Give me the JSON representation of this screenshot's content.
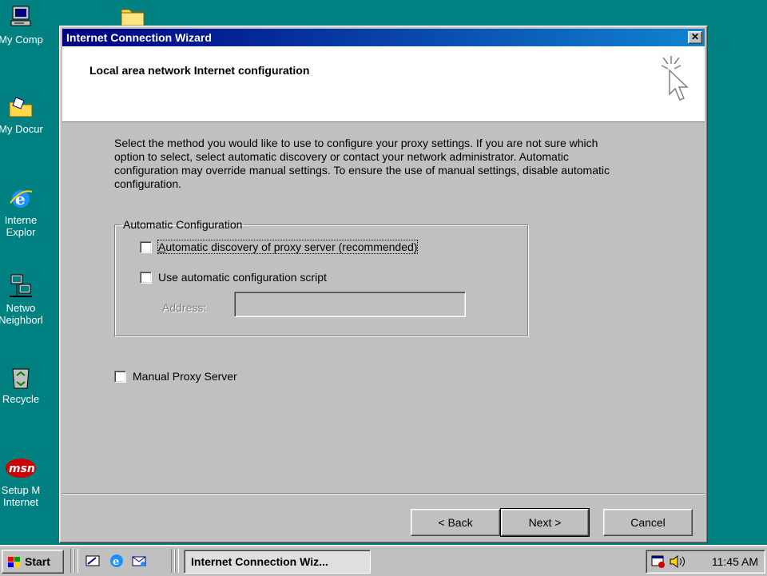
{
  "desktop": {
    "icons": [
      {
        "label": "My Comp",
        "icon": "my-computer-icon"
      },
      {
        "label": "",
        "icon": "folder-icon"
      },
      {
        "label": "My Docur",
        "icon": "my-documents-icon"
      },
      {
        "label": "Interne\nExplor",
        "icon": "internet-explorer-icon"
      },
      {
        "label": "Netwo\nNeighborl",
        "icon": "network-neighborhood-icon"
      },
      {
        "label": "Recycle",
        "icon": "recycle-bin-icon"
      },
      {
        "label": "Setup M\nInternet",
        "icon": "msn-icon"
      }
    ]
  },
  "window": {
    "title": "Internet Connection Wizard",
    "close_glyph": "✕",
    "header_title": "Local area network Internet configuration",
    "description": "Select the method you would like to use to configure your proxy settings.  If you are not sure which option to select, select automatic discovery or contact your network administrator.  Automatic configuration may override manual settings.  To ensure the use of manual settings, disable automatic configuration.",
    "group_legend": "Automatic Configuration",
    "auto_discovery": {
      "label": "Automatic discovery of proxy server (recommended)",
      "checked": false
    },
    "auto_script": {
      "label": "Use automatic configuration script",
      "checked": false
    },
    "address": {
      "label": "Address:",
      "value": ""
    },
    "manual_proxy": {
      "label": "Manual Proxy Server",
      "checked": false
    },
    "buttons": {
      "back": "< Back",
      "next": "Next >",
      "cancel": "Cancel"
    }
  },
  "taskbar": {
    "start_label": "Start",
    "quicklaunch": [
      "show-desktop-icon",
      "internet-explorer-icon",
      "outlook-express-icon"
    ],
    "task_label": "Internet Connection Wiz...",
    "clock": "11:45 AM"
  },
  "colors": {
    "desktop": "#008080",
    "titlebar": "#000080",
    "face": "#c0c0c0"
  }
}
